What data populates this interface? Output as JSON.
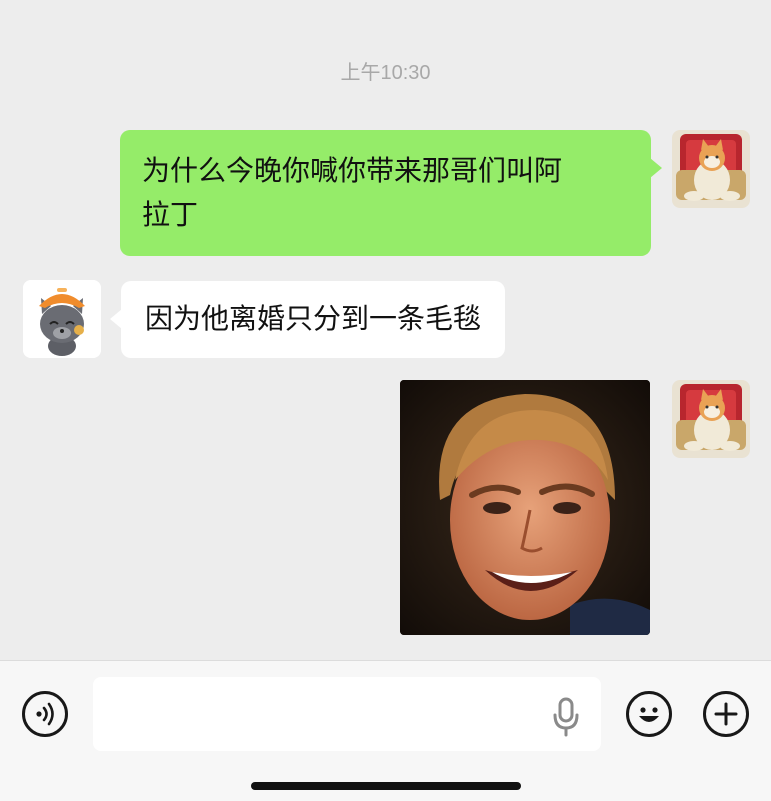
{
  "chat": {
    "timestamp": "上午10:30",
    "messages": [
      {
        "sender": "self",
        "type": "text",
        "text": "为什么今晚你喊你带来那哥们叫阿拉丁",
        "line1": "为什么今晚你喊你带来那哥们叫阿",
        "line2": "拉丁"
      },
      {
        "sender": "other",
        "type": "text",
        "text": "因为他离婚只分到一条毛毯"
      },
      {
        "sender": "self",
        "type": "image"
      }
    ]
  },
  "colors": {
    "background": "#ededed",
    "self_bubble": "#95ec69",
    "other_bubble": "#ffffff",
    "timestamp": "#a8a8a8",
    "input_bar": "#f7f7f7"
  },
  "icons": {
    "voice": "voice-icon",
    "mic": "microphone-icon",
    "emoji": "emoji-icon",
    "add": "plus-icon"
  },
  "input": {
    "value": "",
    "placeholder": ""
  }
}
